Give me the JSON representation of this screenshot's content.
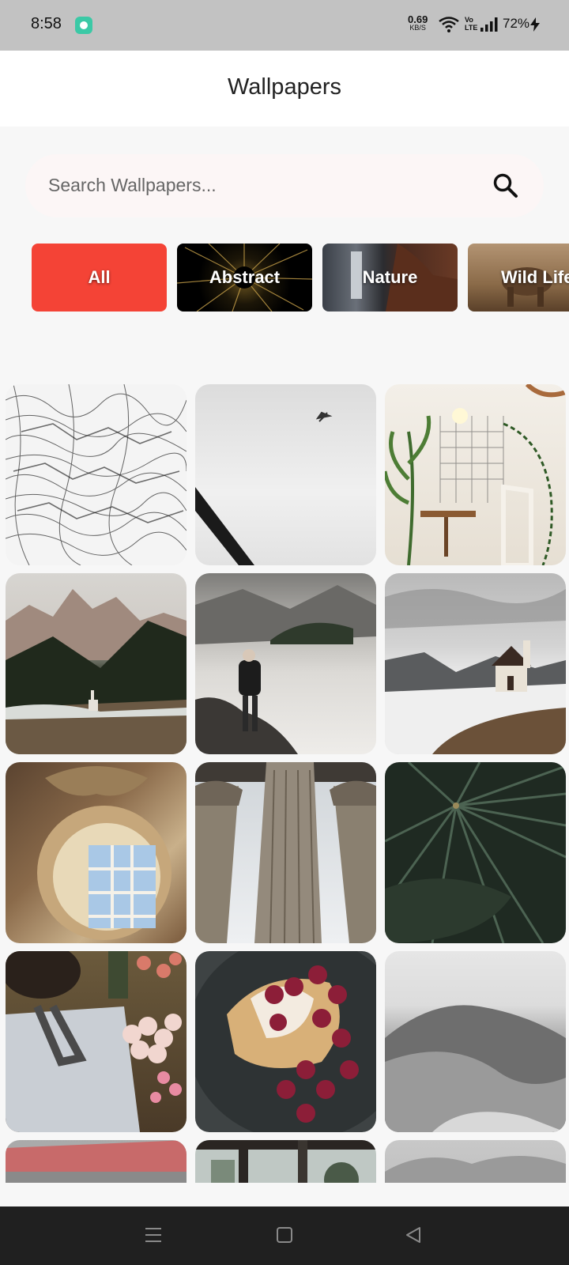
{
  "status_bar": {
    "time": "8:58",
    "net_speed": "0.69",
    "net_unit": "KB/S",
    "volte_top": "Vo",
    "volte_bottom": "LTE",
    "battery": "72%"
  },
  "app_bar": {
    "title": "Wallpapers"
  },
  "search": {
    "placeholder": "Search Wallpapers...",
    "icon": "search-icon"
  },
  "categories": [
    {
      "label": "All",
      "selected": true,
      "color": "#f44336"
    },
    {
      "label": "Abstract",
      "selected": false
    },
    {
      "label": "Nature",
      "selected": false
    },
    {
      "label": "Wild Life",
      "selected": false
    }
  ],
  "wallpapers": [
    "abstract-line-sketch",
    "airplane-misty-sky",
    "plants-cafe-interior",
    "mountain-chapel-forest",
    "person-frozen-lake",
    "snowy-mountain-chapel",
    "baroque-round-window",
    "classical-stone-columns",
    "dark-palm-leaves",
    "woman-flower-bouquet",
    "raspberry-pastry",
    "black-white-hills",
    "red-building",
    "window-frame",
    "cloudy-sky"
  ],
  "accent_color": "#f44336"
}
